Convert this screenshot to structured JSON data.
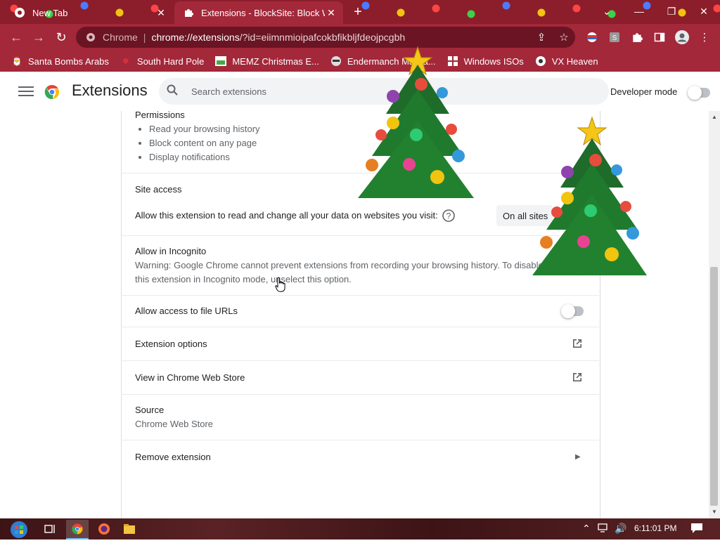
{
  "browser": {
    "tabs": [
      {
        "label": "New Tab",
        "active": false
      },
      {
        "label": "Extensions - BlockSite: Block Websites",
        "active": true
      }
    ],
    "omnibox": {
      "chip": "Chrome",
      "url_host": "chrome://extensions",
      "url_rest": "/?id=eiimnmioipafcokbfikbljfdeojpcgbh"
    },
    "bookmarks": [
      {
        "label": "Santa Bombs Arabs",
        "icon": "santa-icon"
      },
      {
        "label": "South Hard Pole",
        "icon": "snowflake-icon"
      },
      {
        "label": "MEMZ Christmas E...",
        "icon": "image-icon"
      },
      {
        "label": "Endermanch Malwa...",
        "icon": "raccoon-icon"
      },
      {
        "label": "Windows ISOs",
        "icon": "windows-icon"
      },
      {
        "label": "VX Heaven",
        "icon": "vx-icon"
      }
    ]
  },
  "header": {
    "title": "Extensions",
    "search_placeholder": "Search extensions",
    "developer_mode_label": "Developer mode",
    "developer_mode_on": false
  },
  "details": {
    "permissions_title": "Permissions",
    "permissions": [
      "Read your browsing history",
      "Block content on any page",
      "Display notifications"
    ],
    "site_access_title": "Site access",
    "site_access_desc": "Allow this extension to read and change all your data on websites you visit:",
    "site_access_value": "On all sites",
    "incognito_title": "Allow in Incognito",
    "incognito_warning_line1": "Warning: Google Chrome cannot prevent extensions from recording your browsing history. To disable",
    "incognito_warning_line2": "this extension in Incognito mode, unselect this option.",
    "incognito_on": true,
    "file_urls_title": "Allow access to file URLs",
    "file_urls_on": false,
    "extension_options": "Extension options",
    "view_store": "View in Chrome Web Store",
    "source_title": "Source",
    "source_value": "Chrome Web Store",
    "remove": "Remove extension"
  },
  "taskbar": {
    "time": "6:11:01 PM"
  },
  "colors": {
    "accent": "#1a73e8",
    "frame": "#a3283a",
    "tabstrip": "#8c1d2a"
  }
}
